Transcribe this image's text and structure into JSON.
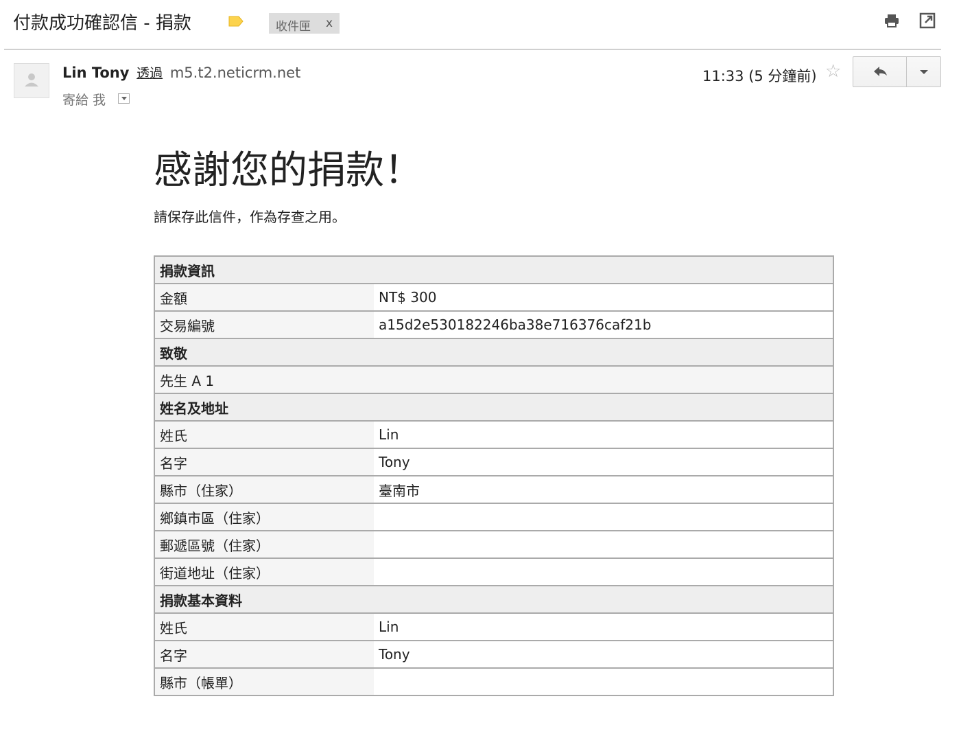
{
  "subject": "付款成功確認信 - 捐款",
  "label_chip": {
    "text": "收件匣",
    "close": "x"
  },
  "sender": {
    "name": "Lin Tony",
    "via": "透過",
    "domain": "m5.t2.neticrm.net",
    "to": "寄給 我"
  },
  "time": "11:33 (5 分鐘前)",
  "star_glyph": "☆",
  "icons": {
    "label": "label-icon",
    "print": "printer-icon",
    "new_window": "new-window-icon",
    "avatar": "person-icon",
    "reply": "reply-icon",
    "more": "chevron-down-icon"
  },
  "body": {
    "heading": "感謝您的捐款！",
    "note": "請保存此信件，作為存查之用。",
    "sections": [
      {
        "title": "捐款資訊",
        "rows": [
          {
            "k": "金額",
            "v": "NT$ 300"
          },
          {
            "k": "交易編號",
            "v": "a15d2e530182246ba38e716376caf21b"
          }
        ]
      },
      {
        "title": "致敬",
        "full": "先生 A 1"
      },
      {
        "title": "姓名及地址",
        "rows": [
          {
            "k": "姓氏",
            "v": "Lin"
          },
          {
            "k": "名字",
            "v": "Tony"
          },
          {
            "k": "縣市（住家）",
            "v": "臺南市"
          },
          {
            "k": "鄉鎮市區（住家）",
            "v": ""
          },
          {
            "k": "郵遞區號（住家）",
            "v": ""
          },
          {
            "k": "街道地址（住家）",
            "v": ""
          }
        ]
      },
      {
        "title": "捐款基本資料",
        "rows": [
          {
            "k": "姓氏",
            "v": "Lin"
          },
          {
            "k": "名字",
            "v": "Tony"
          },
          {
            "k": "縣市（帳單）",
            "v": ""
          }
        ]
      }
    ]
  },
  "colors": {
    "label_yellow": "#fcd34d",
    "chip_bg": "#dddddd",
    "section_bg": "#eeeeee",
    "border": "#aaaaaa"
  }
}
